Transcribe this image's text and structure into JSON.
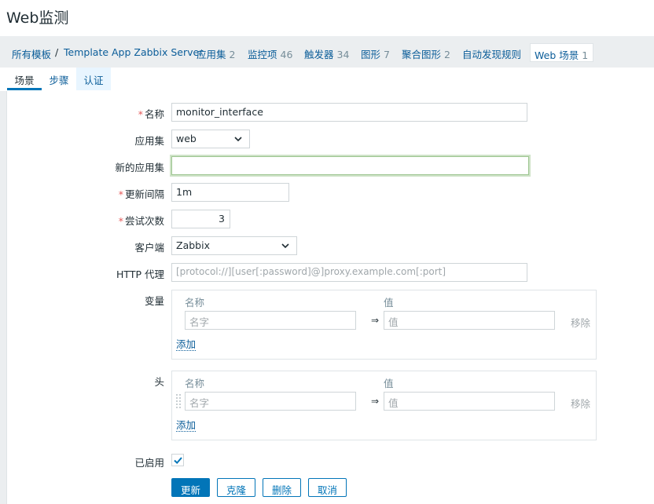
{
  "page": {
    "title": "Web监测"
  },
  "breadcrumbs": {
    "all_templates": "所有模板",
    "separator": "/",
    "template": "Template App Zabbix Server",
    "applications": {
      "label": "应用集",
      "count": "2"
    },
    "items": {
      "label": "监控项",
      "count": "46"
    },
    "triggers": {
      "label": "触发器",
      "count": "34"
    },
    "graphs": {
      "label": "图形",
      "count": "7"
    },
    "screens": {
      "label": "聚合图形",
      "count": "2"
    },
    "discovery": {
      "label": "自动发现规则"
    },
    "web": {
      "label": "Web 场景",
      "count": "1"
    }
  },
  "tabs": {
    "scenario": "场景",
    "steps": "步骤",
    "auth": "认证"
  },
  "form": {
    "name": {
      "label": "名称",
      "required_mark": "*",
      "value": "monitor_interface"
    },
    "application": {
      "label": "应用集",
      "selected": "web"
    },
    "new_application": {
      "label": "新的应用集",
      "value": ""
    },
    "update_interval": {
      "label": "更新间隔",
      "required_mark": "*",
      "value": "1m"
    },
    "attempts": {
      "label": "尝试次数",
      "required_mark": "*",
      "value": "3"
    },
    "agent": {
      "label": "客户端",
      "selected": "Zabbix"
    },
    "http_proxy": {
      "label": "HTTP 代理",
      "placeholder": "[protocol://][user[:password]@]proxy.example.com[:port]"
    },
    "variables": {
      "label": "变量",
      "col_name": "名称",
      "col_value": "值",
      "name_placeholder": "名字",
      "value_placeholder": "值",
      "arrow": "⇒",
      "remove": "移除",
      "add": "添加"
    },
    "headers": {
      "label": "头",
      "col_name": "名称",
      "col_value": "值",
      "name_placeholder": "名字",
      "value_placeholder": "值",
      "arrow": "⇒",
      "remove": "移除",
      "add": "添加"
    },
    "enabled": {
      "label": "已启用",
      "checked": true
    }
  },
  "buttons": {
    "update": "更新",
    "clone": "克隆",
    "delete": "删除",
    "cancel": "取消"
  },
  "colors": {
    "accent": "#0275b8",
    "link": "#0b5d99",
    "required": "#e45959",
    "focus": "#9cc58f"
  }
}
